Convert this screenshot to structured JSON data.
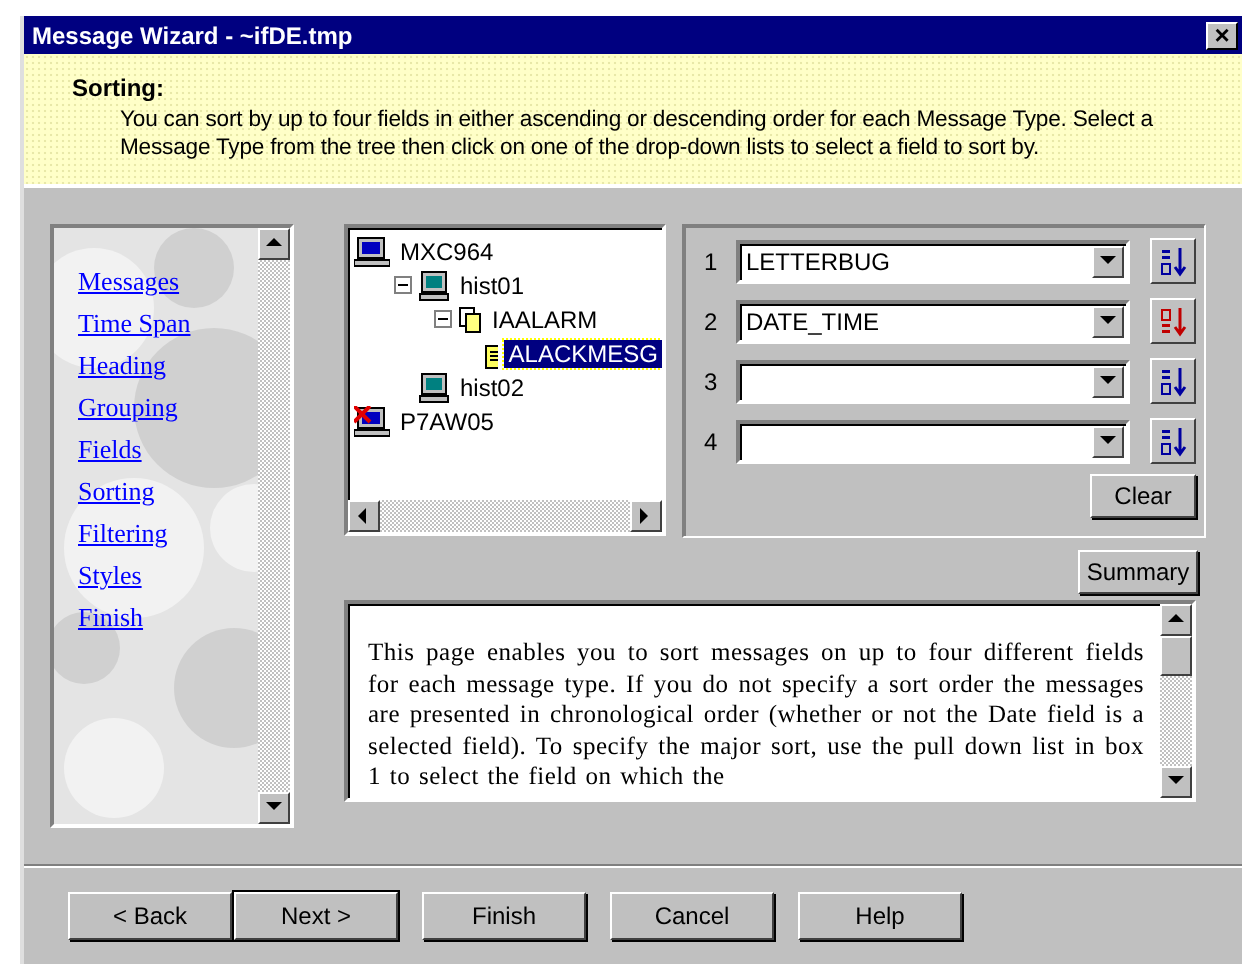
{
  "window": {
    "title": "Message Wizard - ~ifDE.tmp",
    "close": "×"
  },
  "header": {
    "title": "Sorting:",
    "description": "You can sort by up to four fields in either ascending or descending order for each Message Type.  Select a Message Type from the tree then click on one of the drop-down lists to select a field to sort by."
  },
  "nav": {
    "items": [
      {
        "label": "Messages"
      },
      {
        "label": "Time Span"
      },
      {
        "label": "Heading"
      },
      {
        "label": "Grouping"
      },
      {
        "label": "Fields"
      },
      {
        "label": "Sorting"
      },
      {
        "label": "Filtering"
      },
      {
        "label": "Styles"
      },
      {
        "label": "Finish"
      }
    ]
  },
  "tree": {
    "items": [
      {
        "label": "MXC964",
        "kind": "computer",
        "selected": false,
        "children": [
          {
            "label": "hist01",
            "kind": "workstation",
            "selected": false,
            "expanded": true,
            "children": [
              {
                "label": "IAALARM",
                "kind": "folder",
                "selected": false,
                "expanded": true,
                "children": [
                  {
                    "label": "ALACKMESG",
                    "kind": "message",
                    "selected": true
                  }
                ]
              }
            ]
          },
          {
            "label": "hist02",
            "kind": "workstation",
            "selected": false
          }
        ]
      },
      {
        "label": "P7AW05",
        "kind": "offline",
        "selected": false
      }
    ]
  },
  "sort_fields": [
    {
      "number": "1",
      "value": "LETTERBUG",
      "descending": false
    },
    {
      "number": "2",
      "value": "DATE_TIME",
      "descending": true
    },
    {
      "number": "3",
      "descending": false
    },
    {
      "number": "4",
      "descending": false
    }
  ],
  "clear_button": "Clear",
  "summary_button": "Summary",
  "help_text": "This page enables you to sort messages on up to four different fields for each message type. If you do not specify a sort order the messages are presented in chronological order (whether or not the Date field is a selected field). To specify the major sort, use the pull down list in box 1 to select the field on which the",
  "buttons": [
    {
      "label": "< Back",
      "default": false
    },
    {
      "label": "Next >",
      "default": true
    },
    {
      "label": "Finish",
      "default": false
    },
    {
      "label": "Cancel",
      "default": false
    },
    {
      "label": "Help",
      "default": false
    }
  ]
}
